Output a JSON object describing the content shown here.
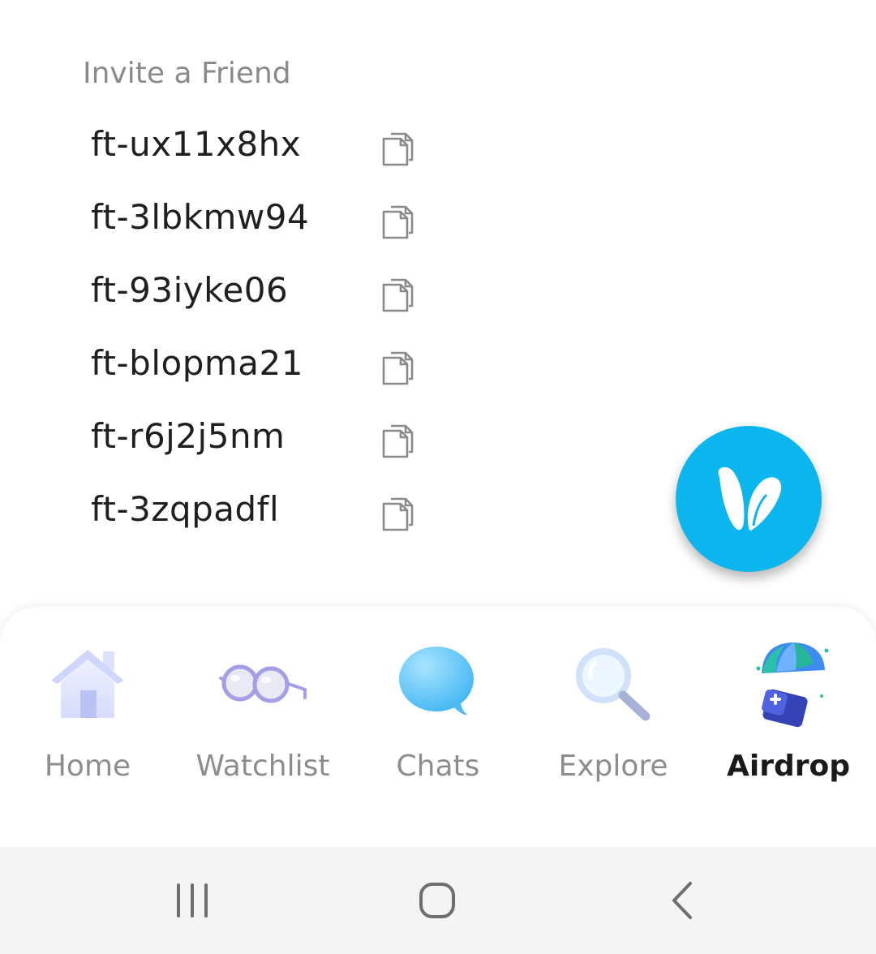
{
  "invite": {
    "title": "Invite a Friend",
    "codes": [
      {
        "code": "ft-ux11x8hx"
      },
      {
        "code": "ft-3lbkmw94"
      },
      {
        "code": "ft-93iyke06"
      },
      {
        "code": "ft-blopma21"
      },
      {
        "code": "ft-r6j2j5nm"
      },
      {
        "code": "ft-3zqpadfl"
      }
    ],
    "copy_icon": "copy-icon"
  },
  "fab": {
    "icon": "bunny-ears-logo-icon",
    "color": "#0bb5ee"
  },
  "tabbar": {
    "active": "Airdrop",
    "tabs": [
      {
        "label": "Home",
        "icon": "house-icon"
      },
      {
        "label": "Watchlist",
        "icon": "glasses-icon"
      },
      {
        "label": "Chats",
        "icon": "chat-bubble-icon"
      },
      {
        "label": "Explore",
        "icon": "magnifier-icon"
      },
      {
        "label": "Airdrop",
        "icon": "parachute-gift-icon"
      }
    ]
  },
  "system_nav": {
    "buttons": [
      {
        "icon": "recent-apps-icon"
      },
      {
        "icon": "home-circle-icon"
      },
      {
        "icon": "back-chevron-icon"
      }
    ]
  }
}
